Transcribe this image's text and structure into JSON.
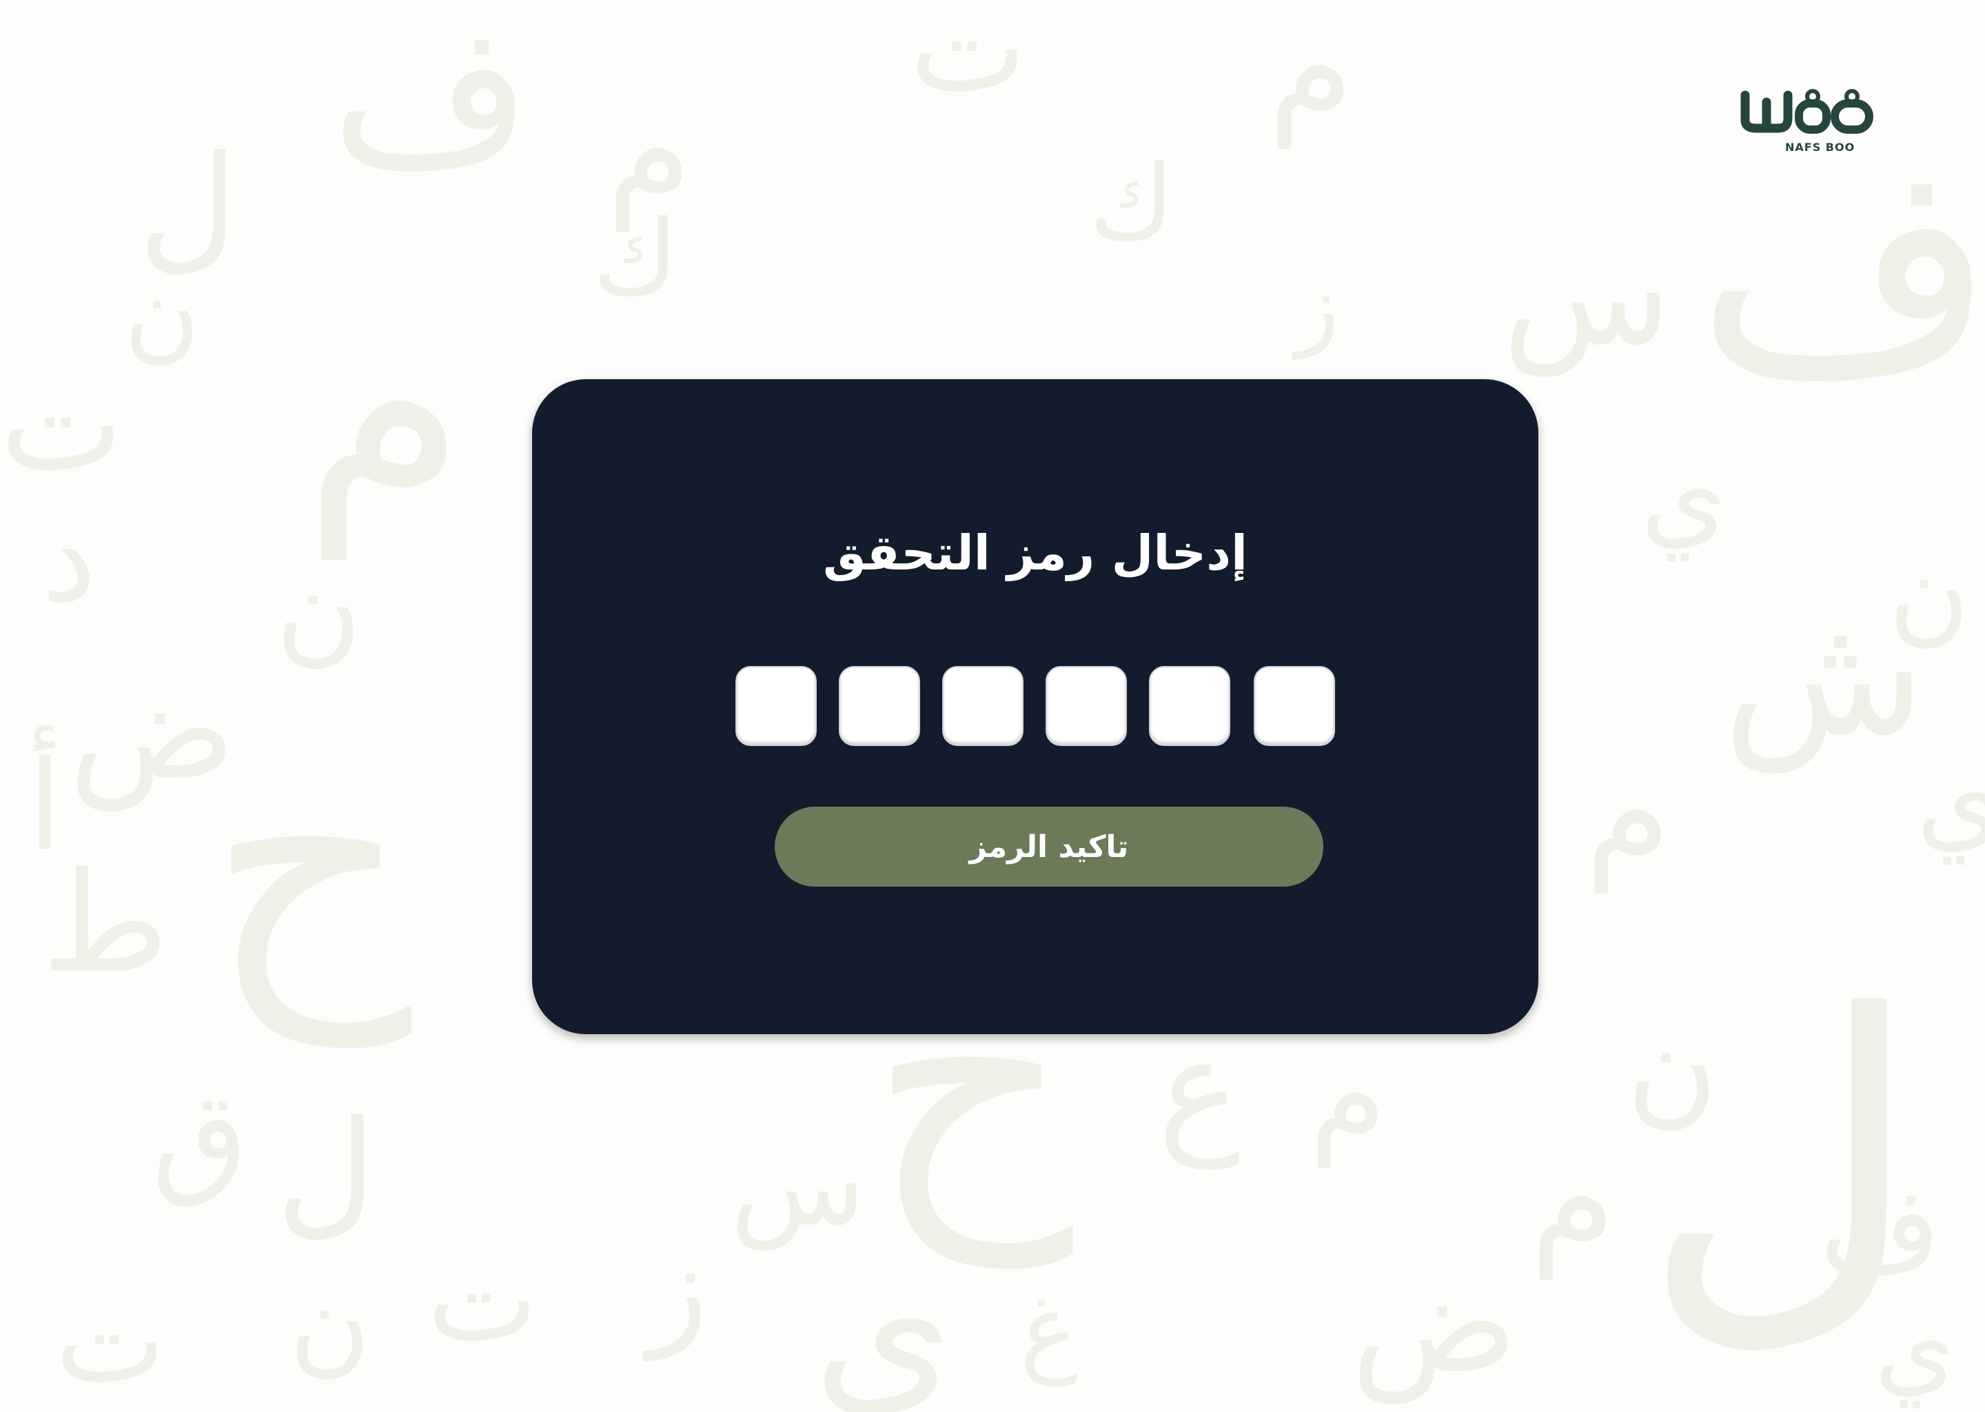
{
  "logo": {
    "caption": "NAFS BOO"
  },
  "otp_card": {
    "title": "إدخال رمز التحقق",
    "code_fields": [
      "",
      "",
      "",
      "",
      "",
      ""
    ],
    "confirm_button_label": "تاكيد الرمز"
  },
  "colors": {
    "page_background": "#fdfdfb",
    "card_background": "#121c2c",
    "button_background": "#6b7b59",
    "logo_green": "#27453f",
    "field_background": "#ffffff"
  },
  "background_letters": [
    "ف",
    "م",
    "ل",
    "ت",
    "ن",
    "ع",
    "س",
    "ر",
    "ك",
    "د",
    "ز",
    "ي",
    "أ",
    "غ",
    "ض",
    "ط",
    "ق",
    "ش",
    "ح"
  ]
}
